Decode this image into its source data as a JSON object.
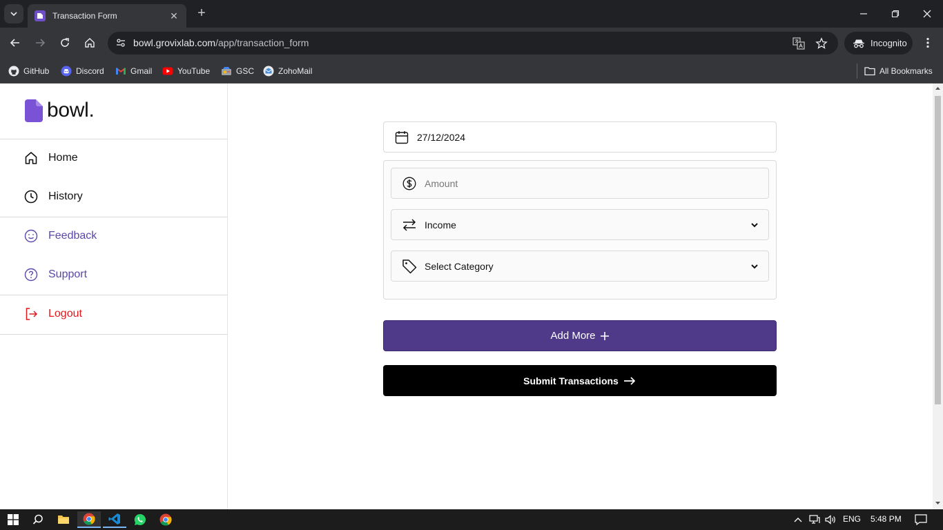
{
  "browser": {
    "tab_title": "Transaction Form",
    "url_host": "bowl.grovixlab.com",
    "url_path": "/app/transaction_form",
    "incognito_label": "Incognito",
    "bookmarks": [
      {
        "label": "GitHub",
        "icon": "github-icon"
      },
      {
        "label": "Discord",
        "icon": "discord-icon"
      },
      {
        "label": "Gmail",
        "icon": "gmail-icon"
      },
      {
        "label": "YouTube",
        "icon": "youtube-icon"
      },
      {
        "label": "GSC",
        "icon": "gsc-icon"
      },
      {
        "label": "ZohoMail",
        "icon": "zohomail-icon"
      }
    ],
    "all_bookmarks_label": "All Bookmarks"
  },
  "app": {
    "logo_text": "bowl.",
    "nav": {
      "home": "Home",
      "history": "History",
      "feedback": "Feedback",
      "support": "Support",
      "logout": "Logout"
    },
    "colors": {
      "accent": "#4f3a8a",
      "link": "#5b47a8",
      "danger": "#e0181e"
    }
  },
  "form": {
    "date_value": "27/12/2024",
    "amount_placeholder": "Amount",
    "type_value": "Income",
    "category_value": "Select Category",
    "add_more_label": "Add More",
    "submit_label": "Submit Transactions"
  },
  "taskbar": {
    "language": "ENG",
    "time": "5:48 PM"
  }
}
